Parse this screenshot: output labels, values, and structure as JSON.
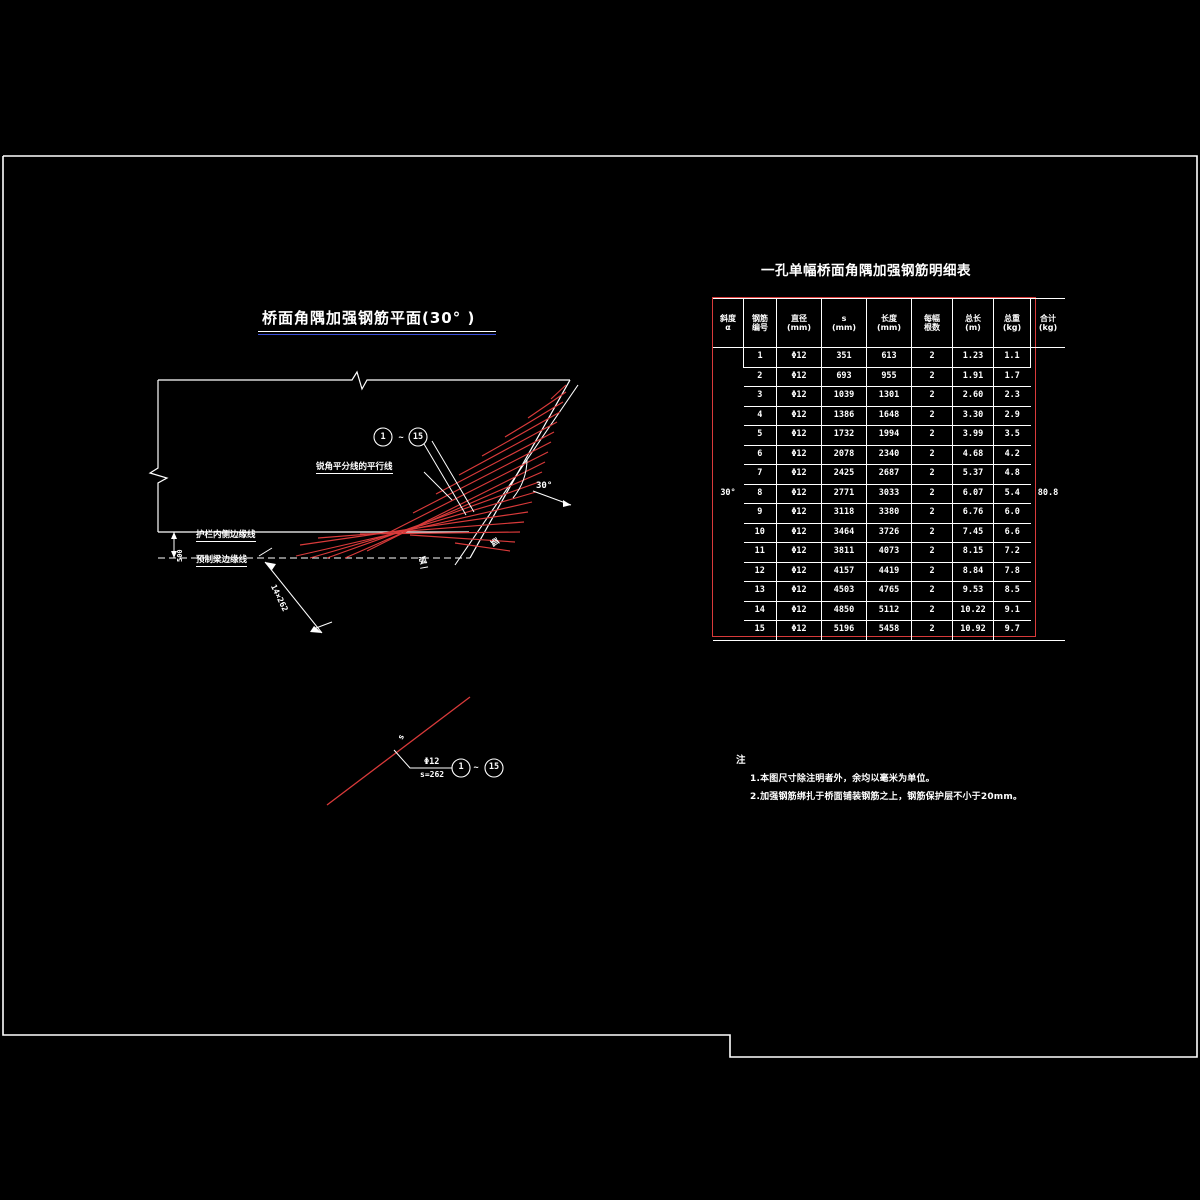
{
  "sheet": {
    "background": "#000000",
    "border_color": "#ffffff",
    "accent_color": "#d93a3a",
    "rebar_color": "#d93a3a",
    "title_rule_color": "#3a4fd8"
  },
  "plan": {
    "title": "桥面角隅加强钢筋平面(30° )",
    "labels": {
      "bisector": "锐角平分线的平行线",
      "guardrail": "护栏内侧边缘线",
      "beam_edge": "预制梁边缘线",
      "angle": "30°",
      "spacing_dim": "14×262",
      "vertical_dim": "500",
      "edge_note_1": "弧",
      "edge_note_2": "弧"
    },
    "bubbles": {
      "first": "1",
      "tilde": "~",
      "last": "15"
    },
    "detail_callout": {
      "s_mark": "s",
      "diameter": "Φ12",
      "spacing": "s=262",
      "bubble_first": "1",
      "bubble_tilde": "~",
      "bubble_last": "15"
    }
  },
  "table": {
    "title": "一孔单幅桥面角隅加强钢筋明细表",
    "headers": [
      {
        "line1": "斜度",
        "line2": "α"
      },
      {
        "line1": "钢筋",
        "line2": "编号"
      },
      {
        "line1": "直径",
        "line2": "(mm)"
      },
      {
        "line1": "s",
        "line2": "(mm)"
      },
      {
        "line1": "长度",
        "line2": "(mm)"
      },
      {
        "line1": "每幅",
        "line2": "根数"
      },
      {
        "line1": "总长",
        "line2": "(m)"
      },
      {
        "line1": "总重",
        "line2": "(kg)"
      },
      {
        "line1": "合计",
        "line2": "(kg)"
      }
    ],
    "skew": "30°",
    "total": "80.8",
    "rows": [
      {
        "no": "1",
        "dia": "Φ12",
        "s": "351",
        "len": "613",
        "count": "2",
        "total_len": "1.23",
        "weight": "1.1"
      },
      {
        "no": "2",
        "dia": "Φ12",
        "s": "693",
        "len": "955",
        "count": "2",
        "total_len": "1.91",
        "weight": "1.7"
      },
      {
        "no": "3",
        "dia": "Φ12",
        "s": "1039",
        "len": "1301",
        "count": "2",
        "total_len": "2.60",
        "weight": "2.3"
      },
      {
        "no": "4",
        "dia": "Φ12",
        "s": "1386",
        "len": "1648",
        "count": "2",
        "total_len": "3.30",
        "weight": "2.9"
      },
      {
        "no": "5",
        "dia": "Φ12",
        "s": "1732",
        "len": "1994",
        "count": "2",
        "total_len": "3.99",
        "weight": "3.5"
      },
      {
        "no": "6",
        "dia": "Φ12",
        "s": "2078",
        "len": "2340",
        "count": "2",
        "total_len": "4.68",
        "weight": "4.2"
      },
      {
        "no": "7",
        "dia": "Φ12",
        "s": "2425",
        "len": "2687",
        "count": "2",
        "total_len": "5.37",
        "weight": "4.8"
      },
      {
        "no": "8",
        "dia": "Φ12",
        "s": "2771",
        "len": "3033",
        "count": "2",
        "total_len": "6.07",
        "weight": "5.4"
      },
      {
        "no": "9",
        "dia": "Φ12",
        "s": "3118",
        "len": "3380",
        "count": "2",
        "total_len": "6.76",
        "weight": "6.0"
      },
      {
        "no": "10",
        "dia": "Φ12",
        "s": "3464",
        "len": "3726",
        "count": "2",
        "total_len": "7.45",
        "weight": "6.6"
      },
      {
        "no": "11",
        "dia": "Φ12",
        "s": "3811",
        "len": "4073",
        "count": "2",
        "total_len": "8.15",
        "weight": "7.2"
      },
      {
        "no": "12",
        "dia": "Φ12",
        "s": "4157",
        "len": "4419",
        "count": "2",
        "total_len": "8.84",
        "weight": "7.8"
      },
      {
        "no": "13",
        "dia": "Φ12",
        "s": "4503",
        "len": "4765",
        "count": "2",
        "total_len": "9.53",
        "weight": "8.5"
      },
      {
        "no": "14",
        "dia": "Φ12",
        "s": "4850",
        "len": "5112",
        "count": "2",
        "total_len": "10.22",
        "weight": "9.1"
      },
      {
        "no": "15",
        "dia": "Φ12",
        "s": "5196",
        "len": "5458",
        "count": "2",
        "total_len": "10.92",
        "weight": "9.7"
      }
    ]
  },
  "notes": {
    "heading": "注",
    "items": [
      "1.本图尺寸除注明者外，余均以毫米为单位。",
      "2.加强钢筋绑扎于桥面铺装钢筋之上，钢筋保护层不小于20mm。"
    ]
  }
}
